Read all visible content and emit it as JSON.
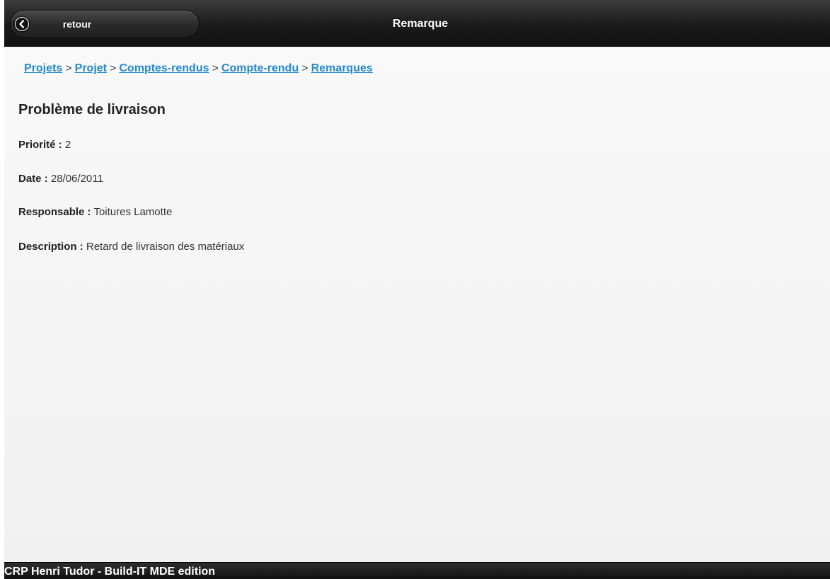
{
  "header": {
    "back_label": "retour",
    "title": "Remarque",
    "back_icon": "chevron-left-circle-icon"
  },
  "breadcrumb": {
    "items": [
      "Projets",
      "Projet",
      "Comptes-rendus",
      "Compte-rendu",
      "Remarques"
    ],
    "separator": ">"
  },
  "remark": {
    "title": "Problème de livraison",
    "fields": [
      {
        "label": "Priorité :",
        "value": "2"
      },
      {
        "label": "Date :",
        "value": "28/06/2011"
      },
      {
        "label": "Responsable :",
        "value": "Toitures Lamotte"
      },
      {
        "label": "Description :",
        "value": "Retard de livraison des matériaux"
      }
    ]
  },
  "footer": {
    "text": "CRP Henri Tudor - Build-IT MDE edition"
  },
  "colors": {
    "link": "#2489ce",
    "bar": "#1a1a1a"
  }
}
